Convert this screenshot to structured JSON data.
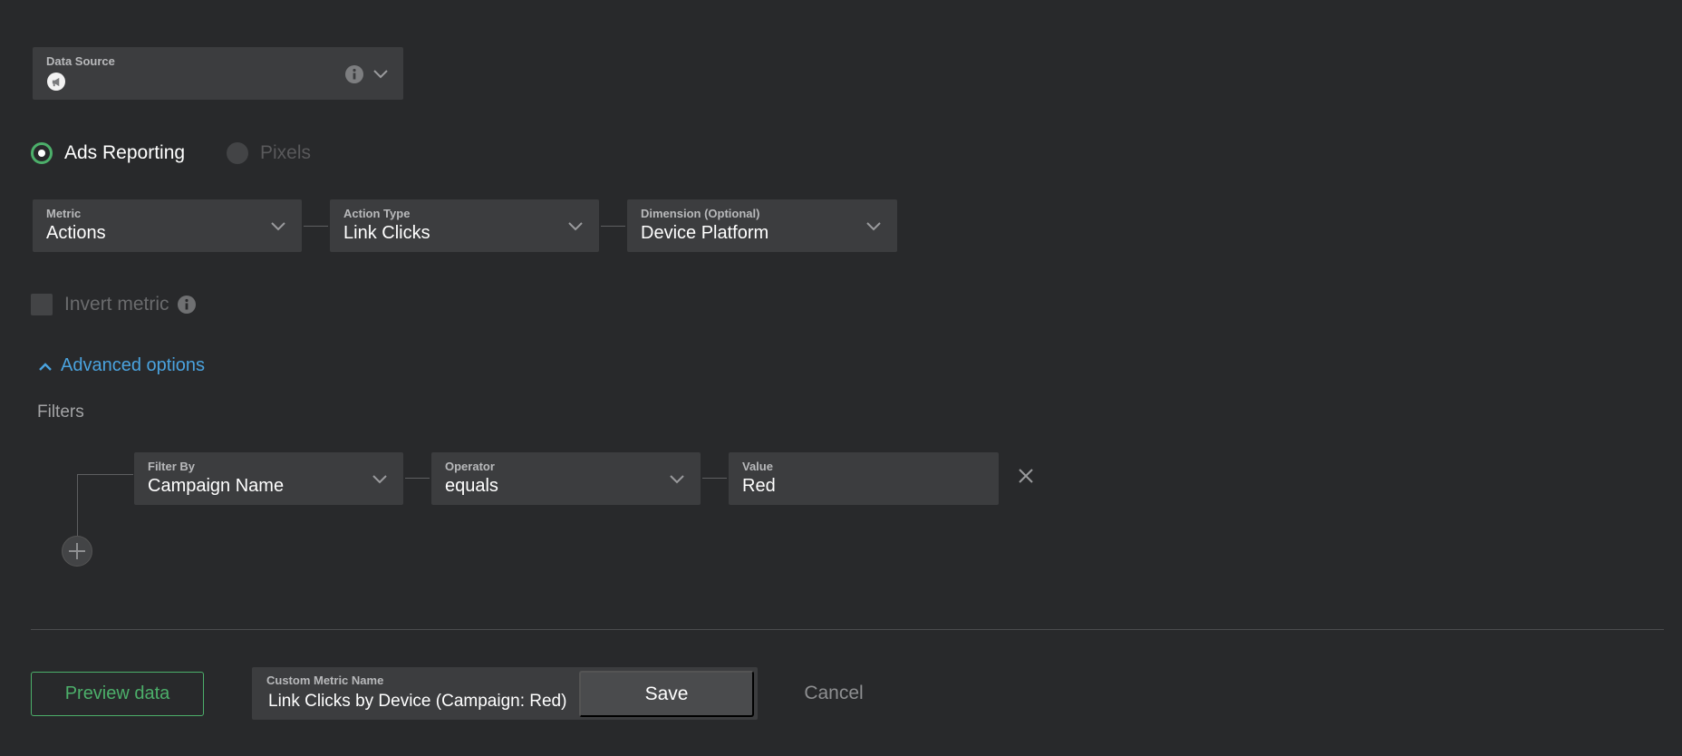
{
  "data_source": {
    "label": "Data Source",
    "value": ""
  },
  "report_type": {
    "options": [
      {
        "label": "Ads Reporting",
        "selected": true
      },
      {
        "label": "Pixels",
        "selected": false
      }
    ]
  },
  "metric": {
    "label": "Metric",
    "value": "Actions"
  },
  "action_type": {
    "label": "Action Type",
    "value": "Link Clicks"
  },
  "dimension": {
    "label": "Dimension (Optional)",
    "value": "Device Platform"
  },
  "invert_metric": {
    "label": "Invert metric",
    "checked": false
  },
  "advanced": {
    "label": "Advanced options",
    "expanded": true
  },
  "filters": {
    "heading": "Filters",
    "rows": [
      {
        "filter_by": {
          "label": "Filter By",
          "value": "Campaign Name"
        },
        "operator": {
          "label": "Operator",
          "value": "equals"
        },
        "value": {
          "label": "Value",
          "value": "Red"
        }
      }
    ]
  },
  "footer": {
    "preview_label": "Preview data",
    "custom_name": {
      "label": "Custom Metric Name",
      "value": "Link Clicks by Device (Campaign: Red)"
    },
    "save_label": "Save",
    "cancel_label": "Cancel"
  },
  "colors": {
    "background": "#28292b",
    "field": "#3c3d3f",
    "accent_green": "#4caf6a",
    "link_blue": "#4aa3df"
  },
  "icons": [
    "megaphone-icon",
    "info-icon",
    "chevron-down-icon",
    "chevron-up-icon",
    "close-icon",
    "plus-icon"
  ]
}
